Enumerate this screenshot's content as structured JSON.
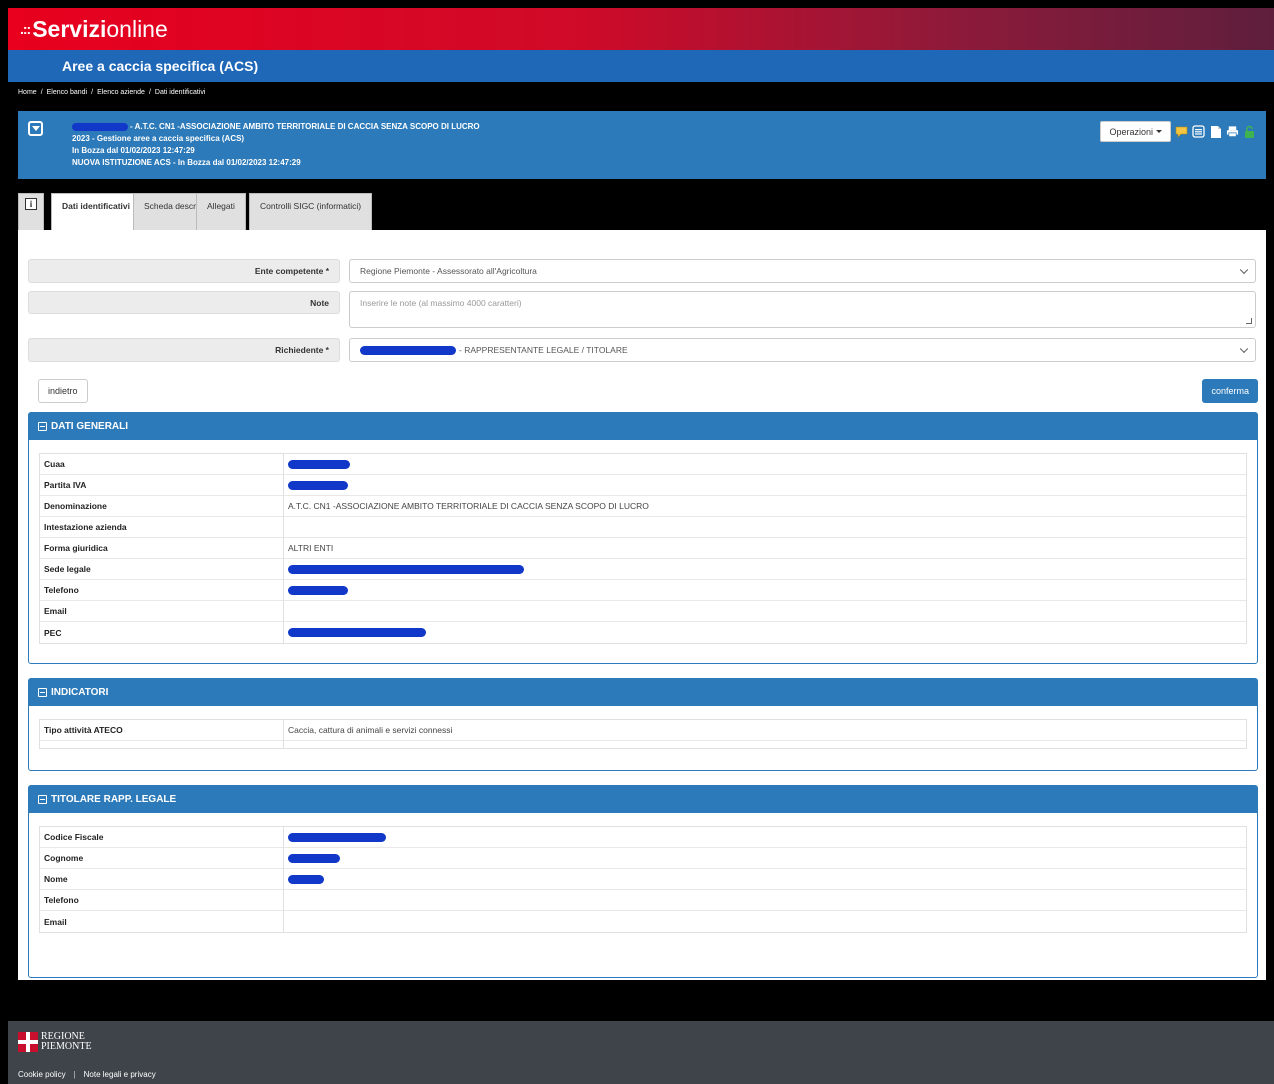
{
  "brand": {
    "dots": ".::",
    "bold": "Servizi",
    "light": "online"
  },
  "title": "Aree a caccia specifica (ACS)",
  "breadcrumb": [
    "Home",
    "Elenco bandi",
    "Elenco aziende",
    "Dati identificativi"
  ],
  "header": {
    "line1": "- A.T.C. CN1 -ASSOCIAZIONE AMBITO TERRITORIALE DI CACCIA SENZA SCOPO DI LUCRO",
    "line2": "2023 - Gestione aree a caccia specifica (ACS)",
    "line3": "In Bozza dal 01/02/2023 12:47:29",
    "line4": "NUOVA ISTITUZIONE ACS - In Bozza dal 01/02/2023 12:47:29",
    "operations_label": "Operazioni"
  },
  "tabs": [
    {
      "label": "Dati identificativi"
    },
    {
      "label": "Scheda descrittiva"
    },
    {
      "label": "Allegati"
    },
    {
      "label": "Controlli SIGC (informatici)"
    }
  ],
  "form": {
    "ente_label": "Ente competente *",
    "ente_value": "Regione Piemonte - Assessorato all'Agricoltura",
    "note_label": "Note",
    "note_placeholder": "Inserire le note (al massimo 4000 caratteri)",
    "richiedente_label": "Richiedente *",
    "richiedente_value": "- RAPPRESENTANTE LEGALE / TITOLARE",
    "back_label": "indietro",
    "confirm_label": "conferma"
  },
  "dati_generali": {
    "title": "DATI GENERALI",
    "rows": [
      {
        "key": "Cuaa",
        "value": ""
      },
      {
        "key": "Partita IVA",
        "value": ""
      },
      {
        "key": "Denominazione",
        "value": "A.T.C. CN1 -ASSOCIAZIONE AMBITO TERRITORIALE DI CACCIA SENZA SCOPO DI LUCRO"
      },
      {
        "key": "Intestazione azienda",
        "value": ""
      },
      {
        "key": "Forma giuridica",
        "value": "ALTRI ENTI"
      },
      {
        "key": "Sede legale",
        "value": ""
      },
      {
        "key": "Telefono",
        "value": ""
      },
      {
        "key": "Email",
        "value": ""
      },
      {
        "key": "PEC",
        "value": ""
      }
    ]
  },
  "indicatori": {
    "title": "INDICATORI",
    "rows": [
      {
        "key": "Tipo attività ATECO",
        "value": "Caccia, cattura di animali e servizi connessi"
      },
      {
        "key": "",
        "value": ""
      }
    ]
  },
  "titolare": {
    "title": "TITOLARE RAPP. LEGALE",
    "rows": [
      {
        "key": "Codice Fiscale",
        "value": ""
      },
      {
        "key": "Cognome",
        "value": ""
      },
      {
        "key": "Nome",
        "value": ""
      },
      {
        "key": "Telefono",
        "value": ""
      },
      {
        "key": "Email",
        "value": ""
      }
    ]
  },
  "footer": {
    "logo_line1": "REGIONE",
    "logo_line2": "PIEMONTE",
    "cookie": "Cookie policy",
    "divider": "|",
    "legal": "Note legali e privacy"
  },
  "colors": {
    "brand_red": "#e8001e",
    "title_blue": "#1f68b8",
    "panel_blue": "#2c7ab9",
    "redaction": "#1238c9",
    "footer": "#3e4449"
  },
  "icons": [
    "comment-icon",
    "list-icon",
    "document-icon",
    "print-icon",
    "lock-icon"
  ]
}
